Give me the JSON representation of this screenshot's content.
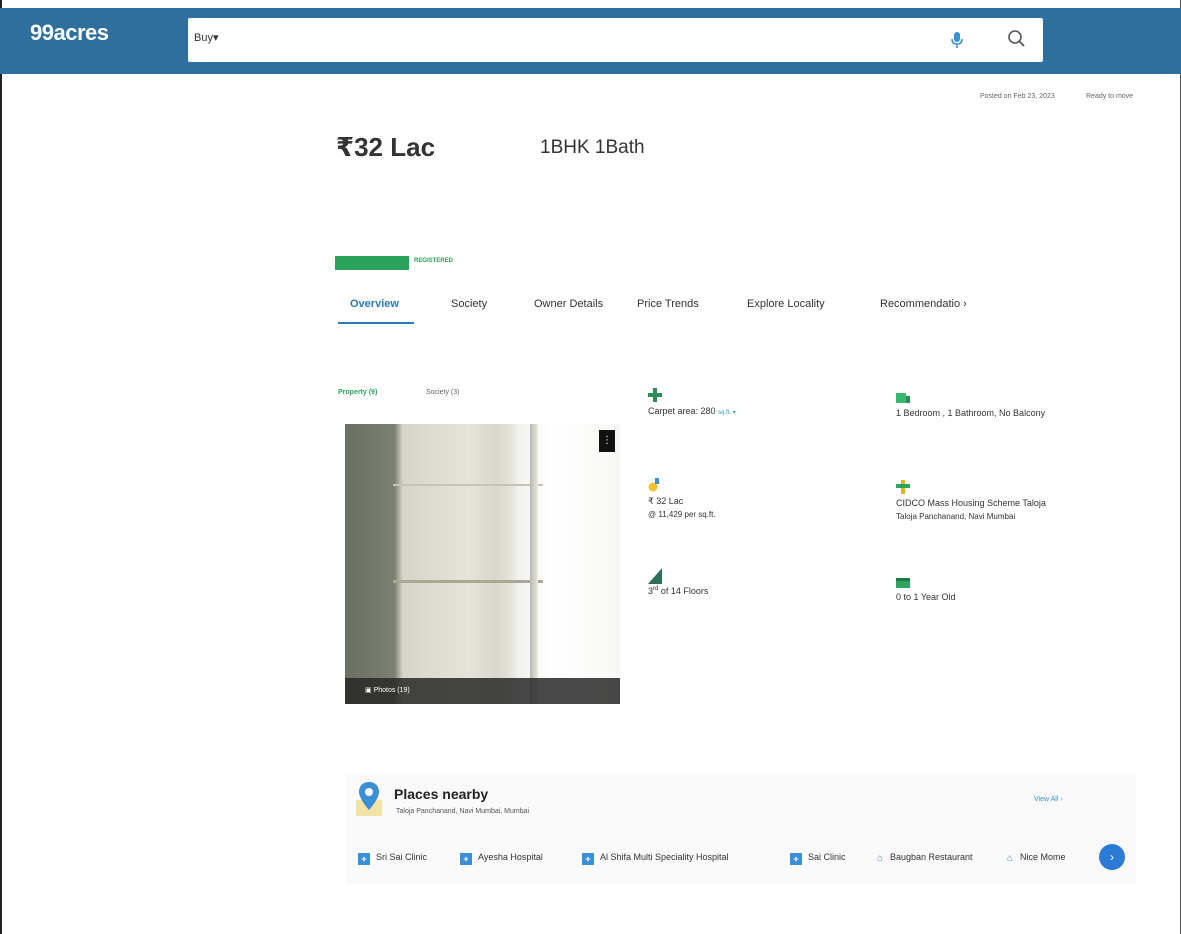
{
  "header": {
    "logo": "99acres",
    "buy_label": "Buy",
    "search_placeholder": "",
    "mic_icon": "mic-icon",
    "search_icon": "search-icon"
  },
  "breadcrumb": {
    "text": "",
    "posted": "Posted on Feb 23, 2023",
    "status": "Ready to move"
  },
  "listing": {
    "price": "32 Lac",
    "currency": "₹",
    "price_per_sqft": "",
    "emi": "",
    "bhk": "1BHK 1Bath",
    "type": "",
    "address": ""
  },
  "rera": {
    "badge": "",
    "status": "REGISTERED",
    "reg_no": "",
    "website": ""
  },
  "tabs": [
    {
      "label": "Overview",
      "active": true
    },
    {
      "label": "Society"
    },
    {
      "label": "Owner Details"
    },
    {
      "label": "Price Trends"
    },
    {
      "label": "Explore Locality"
    },
    {
      "label": "Recommendatio"
    }
  ],
  "gallery": {
    "property_tab": "Property (9)",
    "society_tab": "Society (3)",
    "photos_label": "Photos (19)",
    "menu_glyph": "⋮"
  },
  "details": {
    "area_label": "",
    "area_value": "Carpet area: 280",
    "area_unit": "sq.ft.",
    "config_label": "",
    "config_value": "1 Bedroom , 1 Bathroom, No Balcony",
    "price_label": "",
    "price_value": "₹ 32 Lac",
    "price_per": "@ 11,429 per sq.ft.",
    "price_neg": "",
    "address_label": "",
    "address_line1": "CIDCO Mass Housing Scheme Taloja",
    "address_line2": "Taloja Panchanand, Navi Mumbai",
    "floor_label": "",
    "floor_value": "3",
    "floor_sup": "rd",
    "floor_total": "of 14 Floors",
    "age_label": "",
    "age_value": "0 to 1 Year Old",
    "age_link": ""
  },
  "places": {
    "title": "Places nearby",
    "subtitle": "Taloja Panchanand, Navi Mumbai, Mumbai",
    "view_all": "View All",
    "items": [
      {
        "name": "Sri Sai Clinic",
        "kind": "hospital"
      },
      {
        "name": "Ayesha Hospital",
        "kind": "hospital"
      },
      {
        "name": "Al Shifa Multi Speciality Hospital",
        "kind": "hospital"
      },
      {
        "name": "Sai Clinic",
        "kind": "hospital"
      },
      {
        "name": "Baugban Restaurant",
        "kind": "restaurant"
      },
      {
        "name": "Nice Mome",
        "kind": "restaurant"
      }
    ]
  },
  "colors": {
    "header_bg": "#2f6f9e",
    "accent_blue": "#2a7ab8",
    "green": "#29a35a"
  }
}
